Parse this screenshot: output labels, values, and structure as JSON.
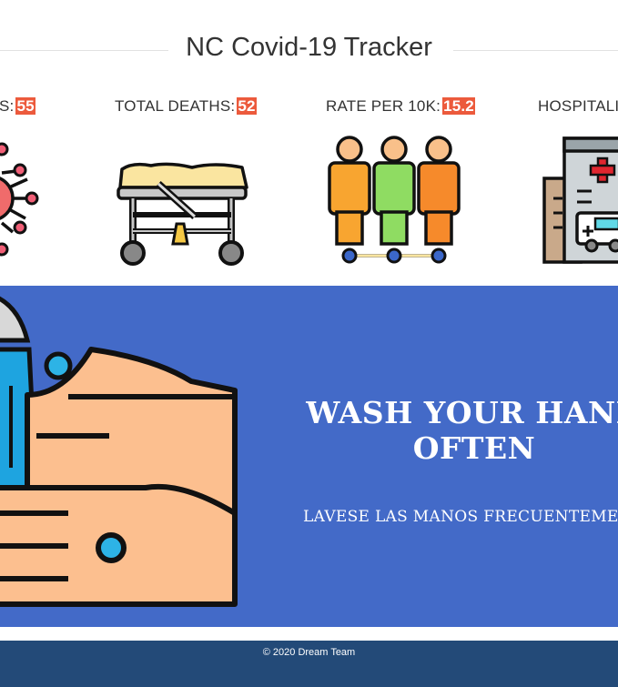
{
  "header": {
    "title": "NC Covid-19 Tracker"
  },
  "stats": [
    {
      "label": "S:",
      "value": "55",
      "icon": "virus-icon"
    },
    {
      "label": "TOTAL DEATHS:",
      "value": "52",
      "icon": "stretcher-icon"
    },
    {
      "label": "RATE PER 10K:",
      "value": "15.2",
      "icon": "people-icon"
    },
    {
      "label": "HOSPITALI",
      "value": "",
      "icon": "hospital-icon"
    }
  ],
  "banner": {
    "title_line1": "WASH YOUR HAND",
    "title_line2": "OFTEN",
    "subtitle": "LAVESE LAS MANOS FRECUENTEMEN",
    "icon": "hand-washing-icon"
  },
  "footer": {
    "text": "© 2020 Dream Team"
  },
  "colors": {
    "accent": "#ec5a3c",
    "banner": "#436ac8",
    "footer": "#234a78"
  }
}
